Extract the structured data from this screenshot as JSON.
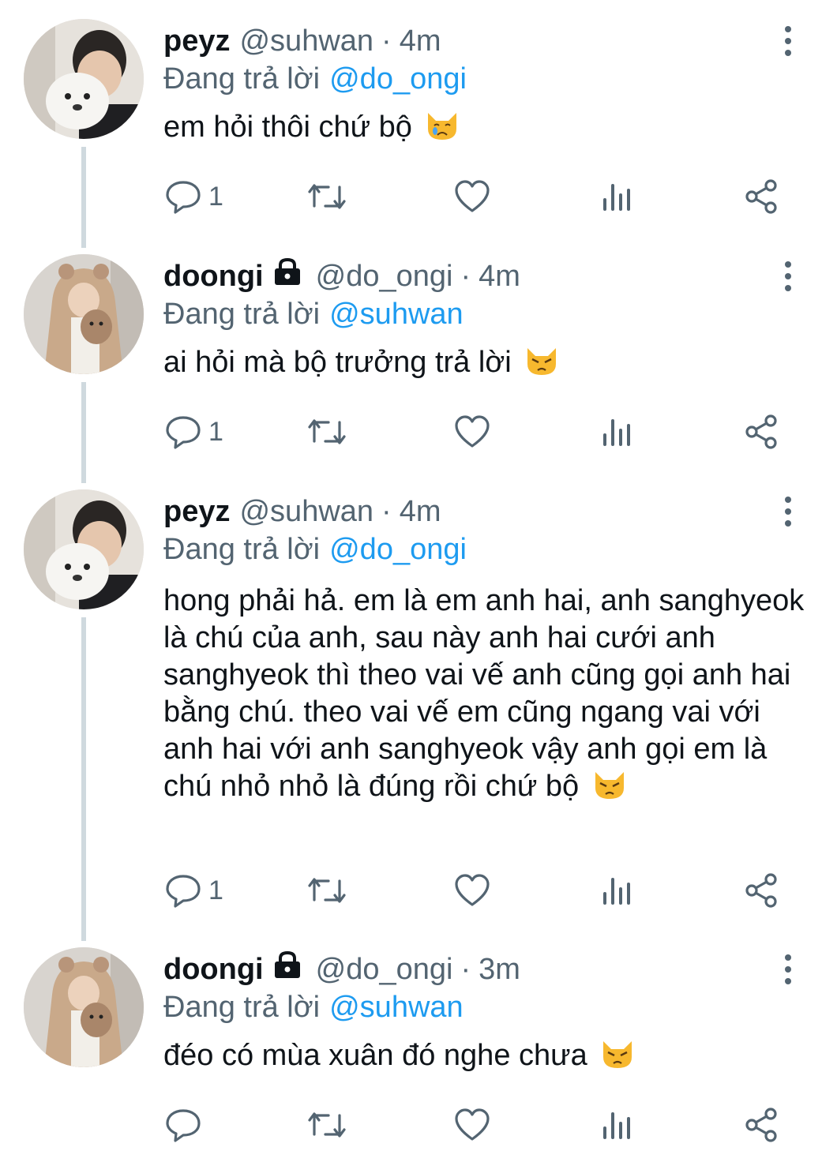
{
  "tweets": [
    {
      "name": "peyz",
      "handle": "@suhwan",
      "separator": "·",
      "time": "4m",
      "locked": false,
      "reply_prefix": "Đang trả lời",
      "reply_to": "@do_ongi",
      "text": "em hỏi thôi chứ bộ",
      "emoji": "crying-cat-icon",
      "reply_count": "1"
    },
    {
      "name": "doongi",
      "handle": "@do_ongi",
      "separator": "·",
      "time": "4m",
      "locked": true,
      "reply_prefix": "Đang trả lời",
      "reply_to": "@suhwan",
      "text": "ai hỏi mà bộ trưởng trả lời",
      "emoji": "pouting-cat-icon",
      "reply_count": "1"
    },
    {
      "name": "peyz",
      "handle": "@suhwan",
      "separator": "·",
      "time": "4m",
      "locked": false,
      "reply_prefix": "Đang trả lời",
      "reply_to": "@do_ongi",
      "text": "hong phải hả. em là em anh hai, anh sanghyeok là chú của anh, sau này anh hai cưới anh sanghyeok thì theo vai vế anh cũng gọi anh hai bằng chú. theo vai vế em cũng ngang vai với anh hai với anh sanghyeok vậy anh gọi em là chú nhỏ nhỏ là đúng rồi chứ bộ",
      "emoji": "pouting-cat-icon",
      "reply_count": "1"
    },
    {
      "name": "doongi",
      "handle": "@do_ongi",
      "separator": "·",
      "time": "3m",
      "locked": true,
      "reply_prefix": "Đang trả lời",
      "reply_to": "@suhwan",
      "text": "đéo có mùa xuân đó nghe chưa",
      "emoji": "pouting-cat-icon",
      "reply_count": ""
    }
  ],
  "colors": {
    "text": "#0f1419",
    "secondary": "#536471",
    "mention": "#1d9bf0",
    "thread_line": "#cfd9de"
  }
}
